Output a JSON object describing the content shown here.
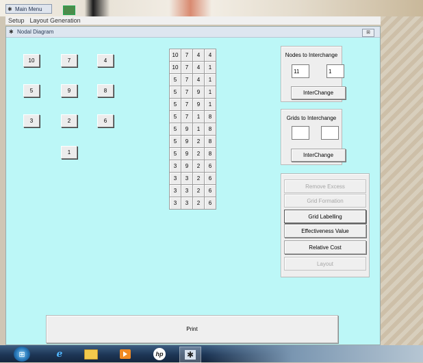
{
  "window": {
    "main_title": "Main Menu",
    "menu": [
      "Setup",
      "Layout Generation"
    ],
    "child_title": "Nodal Diagram",
    "child_close": "⊠"
  },
  "nodes": [
    "10",
    "7",
    "4",
    "5",
    "9",
    "8",
    "3",
    "2",
    "6",
    "1"
  ],
  "grid": [
    [
      "10",
      "7",
      "4",
      "4"
    ],
    [
      "10",
      "7",
      "4",
      "1"
    ],
    [
      "5",
      "7",
      "4",
      "1"
    ],
    [
      "5",
      "7",
      "9",
      "1"
    ],
    [
      "5",
      "7",
      "9",
      "1"
    ],
    [
      "5",
      "7",
      "1",
      "8"
    ],
    [
      "5",
      "9",
      "1",
      "8"
    ],
    [
      "5",
      "9",
      "2",
      "8"
    ],
    [
      "5",
      "9",
      "2",
      "8"
    ],
    [
      "3",
      "9",
      "2",
      "6"
    ],
    [
      "3",
      "3",
      "2",
      "6"
    ],
    [
      "3",
      "3",
      "2",
      "6"
    ],
    [
      "3",
      "3",
      "2",
      "6"
    ]
  ],
  "nodes_panel": {
    "label": "Nodes to Interchange",
    "input1": "11",
    "input2": "1",
    "button": "InterChange"
  },
  "grids_panel": {
    "label": "Grids to Interchange",
    "input1": "",
    "input2": "",
    "button": "InterChange"
  },
  "actions": {
    "remove_excess": "Remove Excess",
    "grid_formation": "Grid Formation",
    "grid_labelling": "Grid Labelling",
    "effectiveness": "Effectiveness Value",
    "relative_cost": "Relative Cost",
    "layout": "Layout"
  },
  "print_label": "Print",
  "taskbar": {
    "hp_label": "hp",
    "ie_glyph": "e"
  },
  "colors": {
    "form_background": "#bcf7f7",
    "button_face": "#efefef",
    "disabled_text": "#a6a6a6"
  }
}
